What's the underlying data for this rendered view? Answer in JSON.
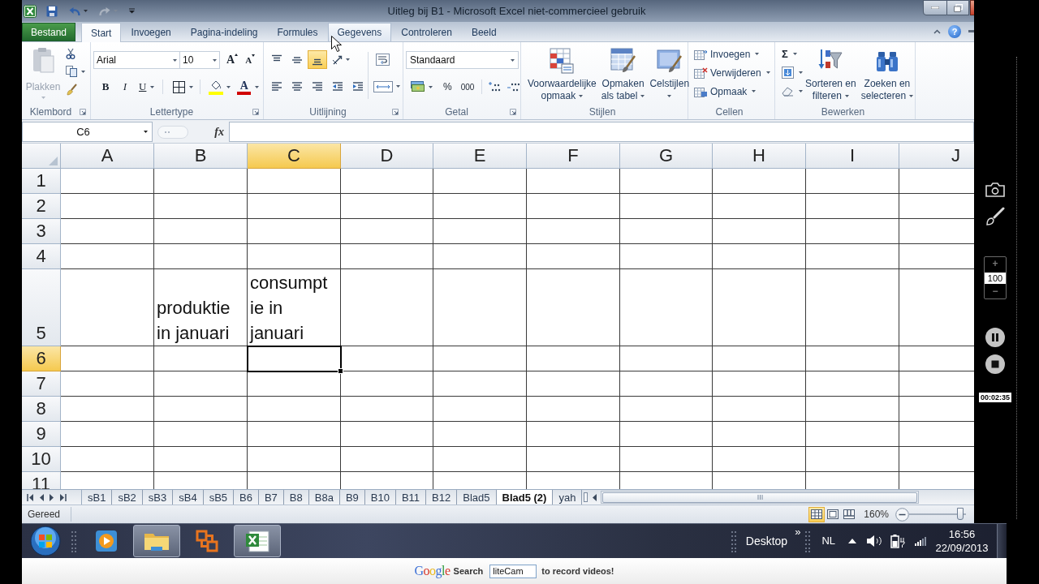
{
  "window": {
    "title": "Uitleg bij B1 - Microsoft Excel niet-commercieel gebruik"
  },
  "quick_access": [
    {
      "kind": "save",
      "disabled": false
    },
    {
      "kind": "undo",
      "disabled": false
    },
    {
      "kind": "redo",
      "disabled": true
    },
    {
      "kind": "customize",
      "disabled": false
    }
  ],
  "ribbon_tabs": [
    {
      "label": "Bestand",
      "kind": "file",
      "selected": false,
      "hovered": false
    },
    {
      "label": "Start",
      "kind": "tab",
      "selected": true,
      "hovered": false
    },
    {
      "label": "Invoegen",
      "kind": "tab",
      "selected": false,
      "hovered": false
    },
    {
      "label": "Pagina-indeling",
      "kind": "tab",
      "selected": false,
      "hovered": false
    },
    {
      "label": "Formules",
      "kind": "tab",
      "selected": false,
      "hovered": false
    },
    {
      "label": "Gegevens",
      "kind": "tab",
      "selected": false,
      "hovered": true
    },
    {
      "label": "Controleren",
      "kind": "tab",
      "selected": false,
      "hovered": false
    },
    {
      "label": "Beeld",
      "kind": "tab",
      "selected": false,
      "hovered": false
    }
  ],
  "ribbon_help": "?",
  "ribbon": {
    "clipboard": {
      "group": "Klembord",
      "paste": {
        "label": "Plakken",
        "disabled": true
      }
    },
    "font": {
      "group": "Lettertype",
      "font_name": "Arial",
      "font_size": "10",
      "grow": "A",
      "shrink": "A",
      "bold": "B",
      "italic": "I",
      "underline": "U",
      "font_color": "A"
    },
    "alignment": {
      "group": "Uitlijning",
      "button_rows": [
        [
          {
            "kind": "align_top",
            "selected": false
          },
          {
            "kind": "align_middle",
            "selected": false
          },
          {
            "kind": "align_bottom",
            "selected": true
          },
          {
            "kind": "orientation",
            "selected": false
          }
        ],
        [
          {
            "kind": "align_left",
            "selected": false
          },
          {
            "kind": "align_center",
            "selected": false
          },
          {
            "kind": "align_right",
            "selected": false
          },
          {
            "kind": "indent_decrease",
            "selected": false
          },
          {
            "kind": "indent_increase",
            "selected": false
          }
        ]
      ]
    },
    "number": {
      "group": "Getal",
      "format": "Standaard",
      "percent": "%",
      "thousands": "000"
    },
    "styles": {
      "group": "Stijlen",
      "buttons": [
        {
          "kind": "conditional",
          "lines": [
            "Voorwaardelijke",
            "opmaak"
          ]
        },
        {
          "kind": "table",
          "lines": [
            "Opmaken",
            "als tabel"
          ]
        },
        {
          "kind": "cell_styles",
          "lines": [
            "Celstijlen"
          ]
        }
      ]
    },
    "cells": {
      "group": "Cellen",
      "buttons": [
        {
          "kind": "insert",
          "label": "Invoegen"
        },
        {
          "kind": "delete",
          "label": "Verwijderen"
        },
        {
          "kind": "format",
          "label": "Opmaak"
        }
      ]
    },
    "editing": {
      "group": "Bewerken",
      "autosum": "Σ",
      "buttons": [
        {
          "kind": "sort",
          "lines": [
            "Sorteren en",
            "filteren"
          ]
        },
        {
          "kind": "find",
          "lines": [
            "Zoeken en",
            "selecteren"
          ]
        }
      ]
    }
  },
  "formula_bar": {
    "name_box": "C6",
    "function_button": "fx"
  },
  "sheet": {
    "columns": [
      {
        "label": "A",
        "selected": false
      },
      {
        "label": "B",
        "selected": false
      },
      {
        "label": "C",
        "selected": true
      },
      {
        "label": "D",
        "selected": false
      },
      {
        "label": "E",
        "selected": false
      },
      {
        "label": "F",
        "selected": false
      },
      {
        "label": "G",
        "selected": false
      },
      {
        "label": "H",
        "selected": false
      },
      {
        "label": "I",
        "selected": false
      },
      {
        "label": "J",
        "selected": false
      }
    ],
    "rows": [
      {
        "header": "1",
        "selected": false
      },
      {
        "header": "2",
        "selected": false
      },
      {
        "header": "3",
        "selected": false
      },
      {
        "header": "4",
        "selected": false
      },
      {
        "header": "5",
        "selected": false,
        "cells": [
          {
            "active": false
          },
          {
            "lines": [
              "produktie",
              "in januari"
            ],
            "active": false
          },
          {
            "lines": [
              "consumpt",
              "ie in",
              "januari"
            ],
            "active": false
          }
        ]
      },
      {
        "header": "6",
        "selected": true,
        "cells": [
          {
            "active": false
          },
          {
            "active": false
          },
          {
            "active": true
          }
        ]
      },
      {
        "header": "7",
        "selected": false
      },
      {
        "header": "8",
        "selected": false
      },
      {
        "header": "9",
        "selected": false
      },
      {
        "header": "10",
        "selected": false
      },
      {
        "header": "11",
        "selected": false
      }
    ]
  },
  "sheet_tabs": [
    {
      "label": "sB1",
      "selected": false
    },
    {
      "label": "sB2",
      "selected": false
    },
    {
      "label": "sB3",
      "selected": false
    },
    {
      "label": "sB4",
      "selected": false
    },
    {
      "label": "sB5",
      "selected": false
    },
    {
      "label": "B6",
      "selected": false
    },
    {
      "label": "B7",
      "selected": false
    },
    {
      "label": "B8",
      "selected": false
    },
    {
      "label": "B8a",
      "selected": false
    },
    {
      "label": "B9",
      "selected": false
    },
    {
      "label": "B10",
      "selected": false
    },
    {
      "label": "B11",
      "selected": false
    },
    {
      "label": "B12",
      "selected": false
    },
    {
      "label": "Blad5",
      "selected": false
    },
    {
      "label": "Blad5 (2)",
      "selected": true
    },
    {
      "label": "yah",
      "selected": false
    }
  ],
  "status_bar": {
    "status": "Gereed",
    "views": [
      {
        "kind": "normal",
        "selected": true
      },
      {
        "kind": "page_layout",
        "selected": false
      },
      {
        "kind": "page_break",
        "selected": false
      }
    ],
    "zoom": "160%",
    "zoom_slider": {
      "level": 0.9
    }
  },
  "taskbar": {
    "apps": [
      {
        "kind": "media_player",
        "active": false
      },
      {
        "kind": "file_explorer",
        "active": true
      },
      {
        "kind": "office",
        "active": false
      },
      {
        "kind": "excel",
        "active": true
      }
    ],
    "toolbar": "Desktop",
    "toolbar_chevron": "»",
    "language": "NL",
    "time": "16:56",
    "date": "22/09/2013"
  },
  "ad_bar": {
    "logo": "Google",
    "search_label": "Search",
    "search_value": "liteCam",
    "tagline": "to record videos!"
  },
  "recorder": {
    "zoom_in": "+",
    "zoom_value": "100",
    "zoom_out": "−",
    "elapsed": "00:02:35"
  }
}
